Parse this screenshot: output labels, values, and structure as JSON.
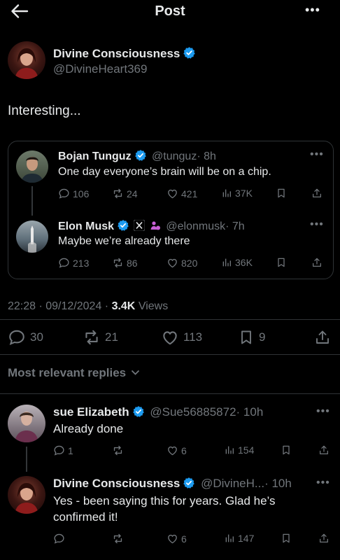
{
  "header": {
    "title": "Post",
    "back": "back-arrow",
    "more": "•••"
  },
  "author": {
    "name": "Divine Consciousness",
    "handle": "@DivineHeart369",
    "verified": true
  },
  "post_text": "Interesting...",
  "quoted": [
    {
      "name": "Bojan Tunguz",
      "handle": "@tunguz",
      "time": "· 8h",
      "text": "One day everyone’s brain will be on a chip.",
      "replies": "106",
      "reposts": "24",
      "likes": "421",
      "views": "37K"
    },
    {
      "name": "Elon Musk",
      "handle": "@elonmusk",
      "time": "· 7h",
      "text": "Maybe we’re already there",
      "replies": "213",
      "reposts": "86",
      "likes": "820",
      "views": "36K"
    }
  ],
  "meta": {
    "datetime": "22:28 · 09/12/2024 ·",
    "views_count": "3.4K",
    "views_label": "Views"
  },
  "actions": {
    "replies": "30",
    "reposts": "21",
    "likes": "113",
    "bookmarks": "9"
  },
  "replies_filter": "Most relevant replies",
  "replies": [
    {
      "name": "sue Elizabeth",
      "handle": "@Sue56885872",
      "time": "· 10h",
      "text": "Already done",
      "replies": "1",
      "likes": "6",
      "views": "154"
    },
    {
      "name": "Divine Consciousness",
      "handle": "@DivineH...",
      "time": "· 10h",
      "text_line1": "Yes - been saying this for years. Glad he’s",
      "text_line2": "confirmed it!",
      "likes": "6",
      "views": "147"
    }
  ],
  "colors": {
    "accent": "#1d9bf0",
    "muted": "#71767b",
    "background": "#000000",
    "purple_badge": "#c85fd6"
  }
}
